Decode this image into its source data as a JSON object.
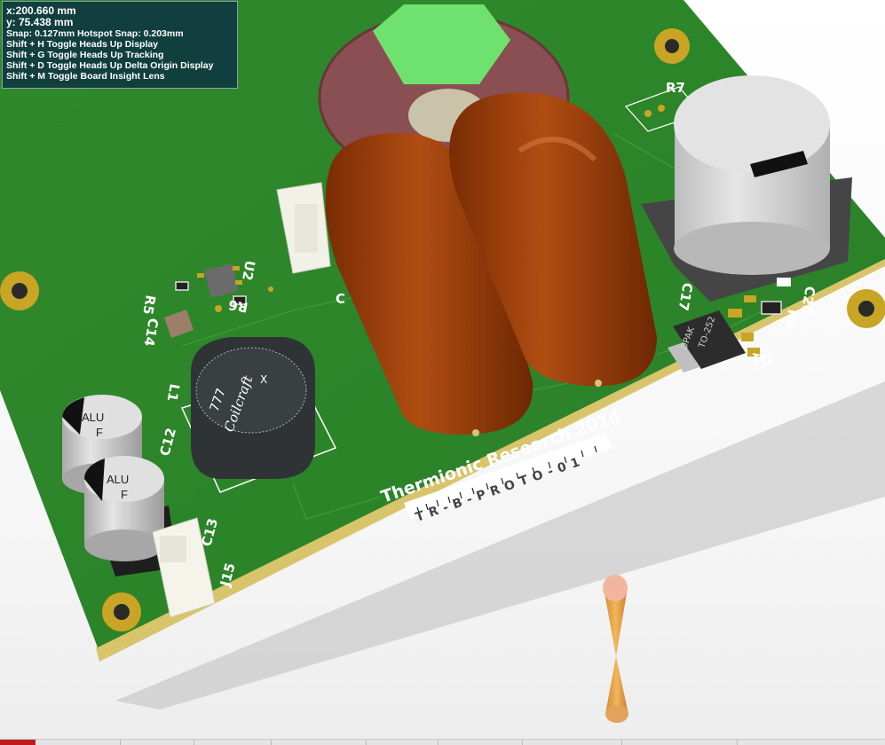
{
  "hud": {
    "x_readout": "x:200.660 mm",
    "y_readout": "y: 75.438  mm",
    "snap": "Snap: 0.127mm Hotspot Snap: 0.203mm",
    "hints": [
      "Shift + H  Toggle Heads Up Display",
      "Shift + G  Toggle Heads Up Tracking",
      "Shift + D  Toggle Heads Up Delta Origin Display",
      "Shift + M  Toggle Board Insight Lens"
    ]
  },
  "board": {
    "company_text": "Thermionic Research 2014",
    "part_number": "TR-B-PROTO-01",
    "designators": {
      "r7": "R7",
      "u2": "U2",
      "r5": "R5",
      "r6": "R6",
      "c14": "C14",
      "c_partial": "C",
      "c17": "C17",
      "c20": "C20",
      "r8": "R8",
      "q1": "Q1",
      "l1": "L1",
      "c12": "C12",
      "c13": "C13",
      "j15": "J15"
    },
    "capacitor_marking_1": "ALU",
    "capacitor_marking_2": "F",
    "capacitor_marking_3": "ALU",
    "capacitor_marking_4": "F",
    "inductor_brand": "Coilcraft",
    "inductor_mark": "X",
    "inductor_dot": "777",
    "dpak_text_1": "DPAK",
    "dpak_text_2": "TO-252"
  },
  "colors": {
    "board_green": "#2e8b2e",
    "hud_bg": "#0e3440",
    "silkscreen": "#ffffff",
    "pad_gold": "#c9a526"
  }
}
